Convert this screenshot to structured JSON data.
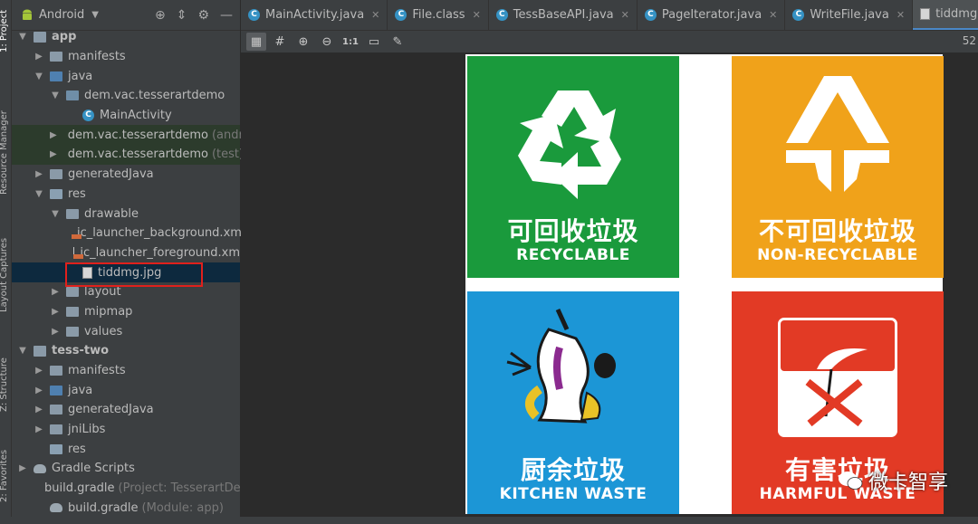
{
  "sidebar_tabs": [
    "1: Project",
    "Resource Manager",
    "Layout Captures",
    "Z: Structure",
    "2: Favorites"
  ],
  "project_panel": {
    "title": "Android",
    "tree": [
      {
        "label": "app",
        "level": 0,
        "expanded": true,
        "icon": "module-icon",
        "bold": true
      },
      {
        "label": "manifests",
        "level": 1,
        "expanded": false,
        "icon": "folder-icon"
      },
      {
        "label": "java",
        "level": 1,
        "expanded": true,
        "icon": "java-folder-icon"
      },
      {
        "label": "dem.vac.tesserartdemo",
        "level": 2,
        "expanded": true,
        "icon": "package-icon"
      },
      {
        "label": "MainActivity",
        "level": 3,
        "icon": "class-icon"
      },
      {
        "label": "dem.vac.tesserartdemo",
        "suffix": "(andro",
        "level": 2,
        "expanded": false,
        "icon": "package-icon",
        "highlight": true
      },
      {
        "label": "dem.vac.tesserartdemo",
        "suffix": "(test)",
        "level": 2,
        "expanded": false,
        "icon": "package-icon",
        "highlight": true
      },
      {
        "label": "generatedJava",
        "level": 1,
        "expanded": false,
        "icon": "generated-folder-icon"
      },
      {
        "label": "res",
        "level": 1,
        "expanded": true,
        "icon": "res-folder-icon"
      },
      {
        "label": "drawable",
        "level": 2,
        "expanded": true,
        "icon": "folder-icon"
      },
      {
        "label": "ic_launcher_background.xm",
        "level": 3,
        "icon": "xml-icon"
      },
      {
        "label": "ic_launcher_foreground.xm",
        "level": 3,
        "icon": "xml-icon"
      },
      {
        "label": "tiddmg.jpg",
        "level": 3,
        "icon": "image-file-icon",
        "selected": true
      },
      {
        "label": "layout",
        "level": 2,
        "expanded": false,
        "icon": "folder-icon"
      },
      {
        "label": "mipmap",
        "level": 2,
        "expanded": false,
        "icon": "folder-icon"
      },
      {
        "label": "values",
        "level": 2,
        "expanded": false,
        "icon": "folder-icon"
      },
      {
        "label": "tess-two",
        "level": 0,
        "expanded": true,
        "icon": "library-module-icon",
        "bold": true
      },
      {
        "label": "manifests",
        "level": 1,
        "expanded": false,
        "icon": "folder-icon"
      },
      {
        "label": "java",
        "level": 1,
        "expanded": false,
        "icon": "java-folder-icon"
      },
      {
        "label": "generatedJava",
        "level": 1,
        "expanded": false,
        "icon": "generated-folder-icon"
      },
      {
        "label": "jniLibs",
        "level": 1,
        "expanded": false,
        "icon": "folder-icon"
      },
      {
        "label": "res",
        "level": 1,
        "icon": "res-folder-icon"
      },
      {
        "label": "Gradle Scripts",
        "level": 0,
        "expanded": false,
        "icon": "gradle-icon"
      },
      {
        "label": "build.gradle",
        "suffix": "(Project: TesserartDe",
        "level": 1,
        "icon": "gradle-icon"
      },
      {
        "label": "build.gradle",
        "suffix": "(Module: app)",
        "level": 1,
        "icon": "gradle-icon"
      }
    ]
  },
  "editor_tabs": [
    {
      "label": "MainActivity.java",
      "icon": "class-icon"
    },
    {
      "label": "File.class",
      "icon": "class-icon"
    },
    {
      "label": "TessBaseAPI.java",
      "icon": "class-icon"
    },
    {
      "label": "PageIterator.java",
      "icon": "class-icon"
    },
    {
      "label": "WriteFile.java",
      "icon": "class-icon"
    },
    {
      "label": "tiddmg.jpg",
      "icon": "image-file-icon",
      "active": true
    }
  ],
  "image_toolbar": {
    "ratio_label": "1:1",
    "zoom_text": "52"
  },
  "image": {
    "quadrants": [
      {
        "cn": "可回收垃圾",
        "en": "RECYCLABLE",
        "color": "#1a9a3c"
      },
      {
        "cn": "不可回收垃圾",
        "en": "NON-RECYCLABLE",
        "color": "#f0a21a"
      },
      {
        "cn": "厨余垃圾",
        "en": "KITCHEN WASTE",
        "color": "#1c96d6"
      },
      {
        "cn": "有害垃圾",
        "en": "HARMFUL WASTE",
        "color": "#e23a25"
      }
    ]
  },
  "watermark": "微卡智享"
}
